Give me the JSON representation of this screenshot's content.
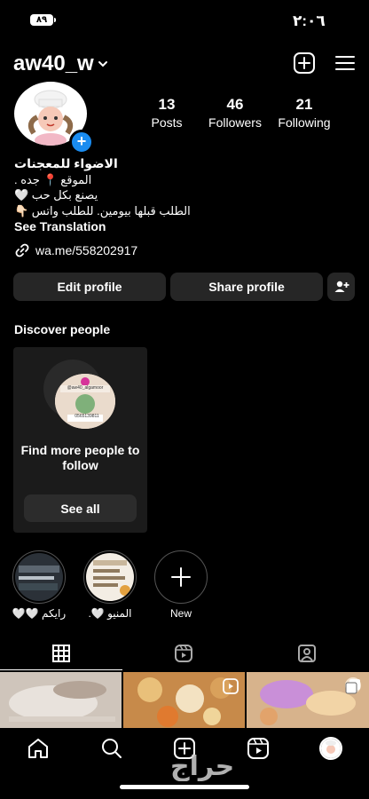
{
  "status_bar": {
    "time": "٢:٠٦",
    "battery": "٨٩"
  },
  "header": {
    "username": "aw40_w"
  },
  "stats": [
    {
      "count": "13",
      "label": "Posts"
    },
    {
      "count": "46",
      "label": "Followers"
    },
    {
      "count": "21",
      "label": "Following"
    }
  ],
  "bio": {
    "name": "الاضواء للمعجنات",
    "lines": [
      "الموقع 📍 جده .",
      "يصنع بكل حب 🤍",
      "الطلب قبلها بيومين. للطلب واتس 👇🏻"
    ],
    "see_translation": "See Translation",
    "link": "wa.me/558202917"
  },
  "actions": {
    "edit_profile": "Edit profile",
    "share_profile": "Share profile"
  },
  "discover": {
    "title": "Discover people",
    "card_text": "Find more people to follow",
    "card_handle": "@aw40_algamoor",
    "card_phone": "0565139811",
    "see_all": "See all"
  },
  "highlights": [
    {
      "label": "رايكم 🤍🤍"
    },
    {
      "label": "المنيو 🤍."
    },
    {
      "label": "New"
    }
  ],
  "watermark": "حراج"
}
